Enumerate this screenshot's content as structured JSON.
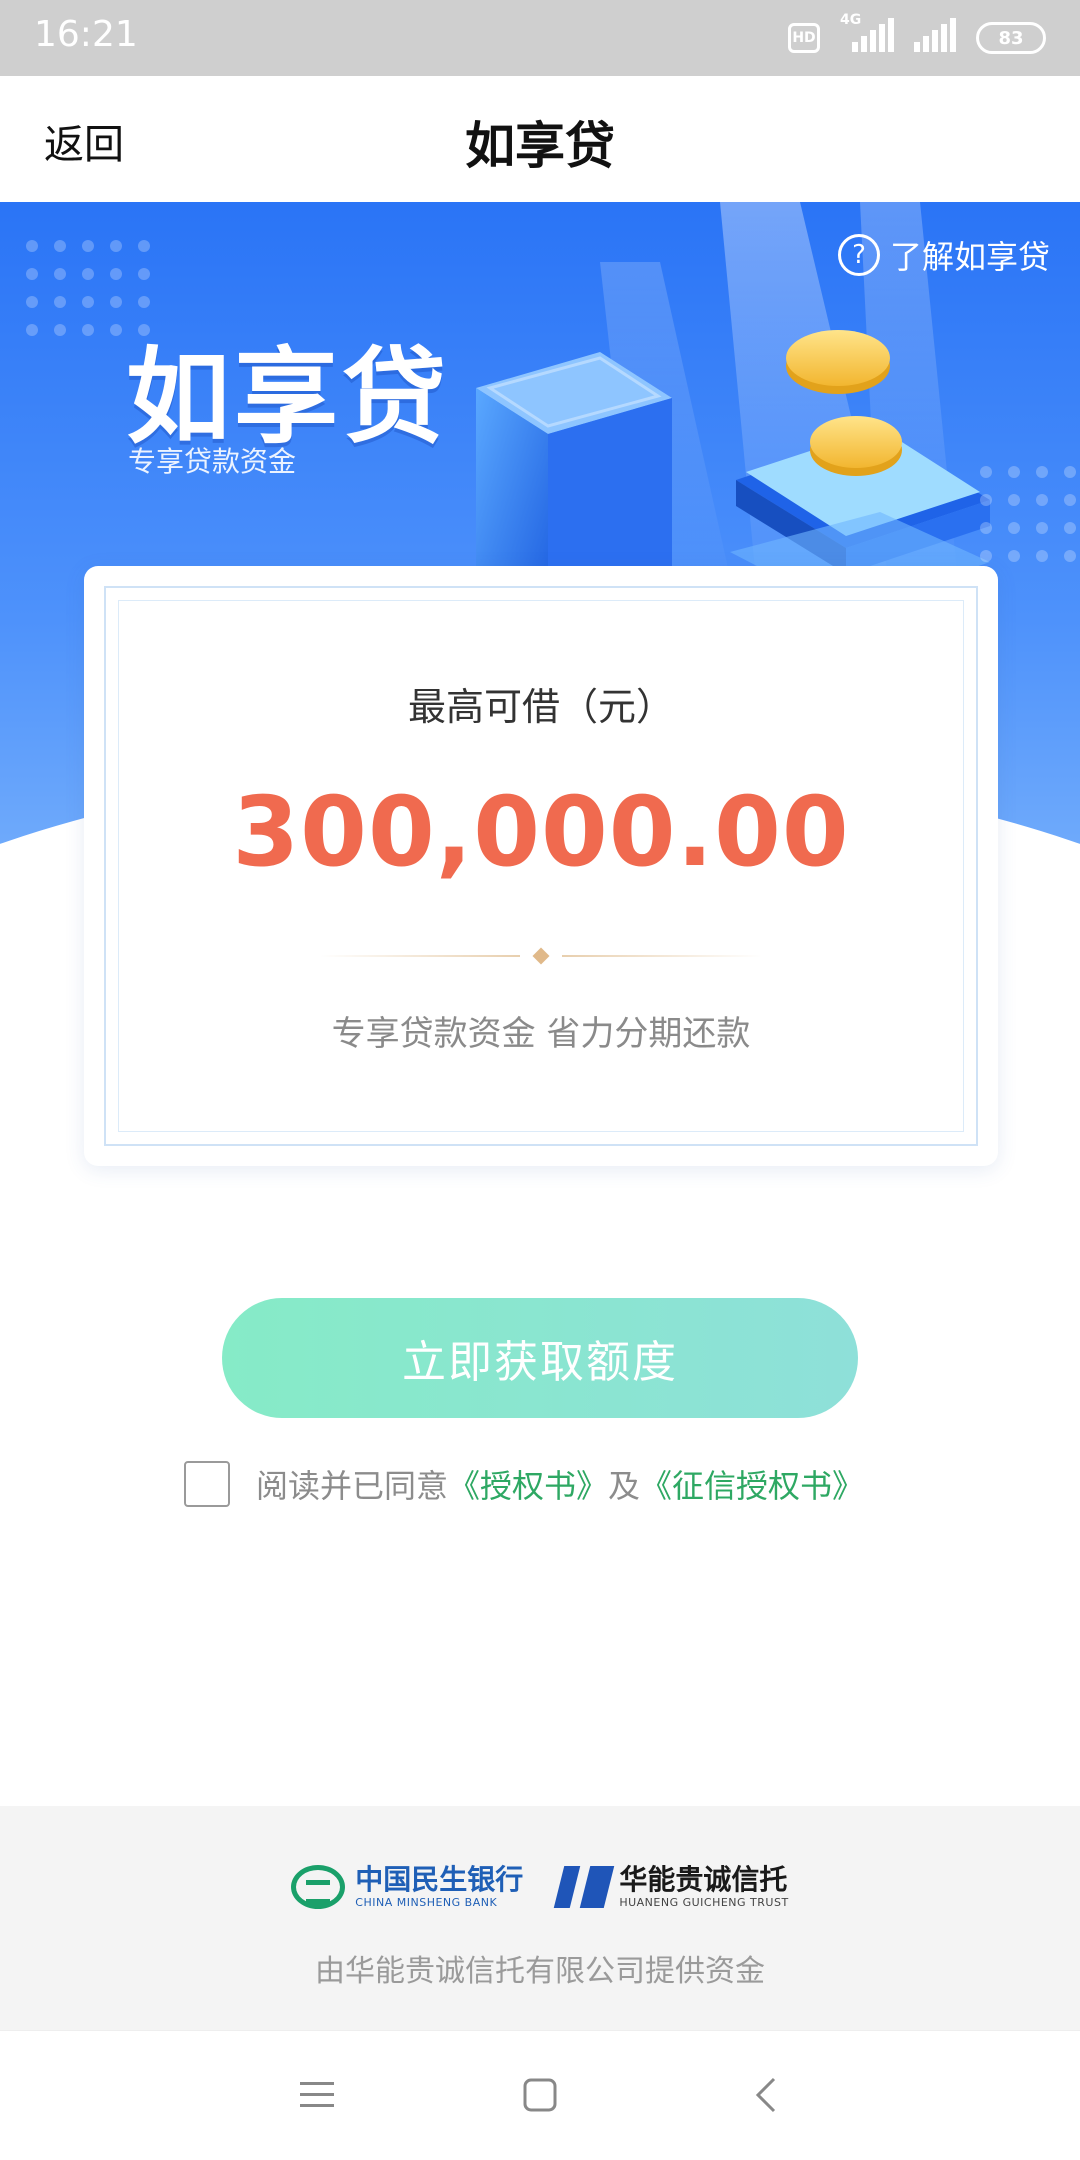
{
  "status_bar": {
    "time": "16:21",
    "hd": "HD",
    "network": "4G",
    "battery": "83"
  },
  "nav": {
    "back_label": "返回",
    "title": "如享贷"
  },
  "banner": {
    "title": "如享贷",
    "subtitle": "专享贷款资金",
    "learn_more": "了解如享贷",
    "learn_icon": "?"
  },
  "card": {
    "label": "最高可借（元）",
    "amount": "300,000.00",
    "tagline": "专享贷款资金 省力分期还款"
  },
  "cta": {
    "label": "立即获取额度"
  },
  "agreement": {
    "prefix": "阅读并已同意",
    "link1": "《授权书》",
    "connector": "及",
    "link2": "《征信授权书》",
    "checked": false
  },
  "footer": {
    "bank1_cn": "中国民生银行",
    "bank1_en": "CHINA MINSHENG BANK",
    "bank2_cn": "华能贵诚信托",
    "bank2_en": "HUANENG GUICHENG TRUST",
    "note": "由华能贵诚信托有限公司提供资金"
  },
  "system_nav": {
    "menu_icon": "menu-icon",
    "home_icon": "home-icon",
    "back_icon": "back-icon"
  },
  "colors": {
    "banner_blue": "#2a74f6",
    "amount_orange": "#f06a4f",
    "cta_green": "#86ebc7",
    "link_green": "#2ea863"
  }
}
